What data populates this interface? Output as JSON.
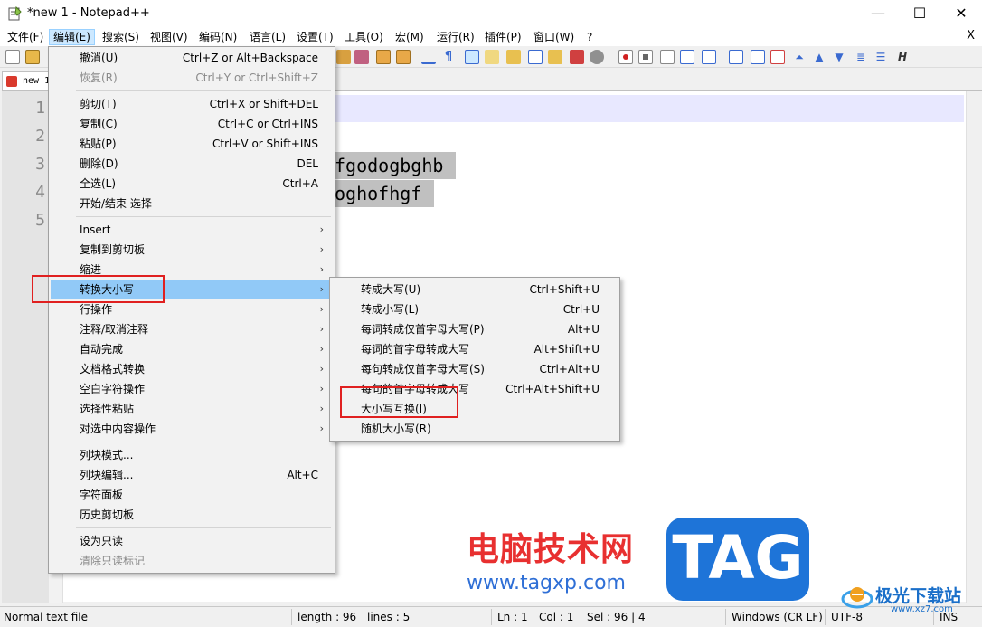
{
  "window": {
    "title": "*new 1 - Notepad++",
    "minimize": "—",
    "maximize": "☐",
    "close": "✕"
  },
  "menubar": {
    "items": [
      "文件(F)",
      "编辑(E)",
      "搜索(S)",
      "视图(V)",
      "编码(N)",
      "语言(L)",
      "设置(T)",
      "工具(O)",
      "宏(M)",
      "运行(R)",
      "插件(P)",
      "窗口(W)",
      "?"
    ],
    "close": "X"
  },
  "tab": {
    "label": "new 1"
  },
  "editor": {
    "line_numbers": [
      "1",
      "2",
      "3",
      "4",
      "5"
    ],
    "visible_text": [
      "fgodogbghb",
      "oghofhgf"
    ]
  },
  "edit_menu": {
    "items": [
      {
        "label": "撤消(U)",
        "shortcut": "Ctrl+Z or Alt+Backspace"
      },
      {
        "label": "恢复(R)",
        "shortcut": "Ctrl+Y or Ctrl+Shift+Z",
        "disabled": true
      },
      {
        "label": "剪切(T)",
        "shortcut": "Ctrl+X or Shift+DEL"
      },
      {
        "label": "复制(C)",
        "shortcut": "Ctrl+C or Ctrl+INS"
      },
      {
        "label": "粘贴(P)",
        "shortcut": "Ctrl+V or Shift+INS"
      },
      {
        "label": "删除(D)",
        "shortcut": "DEL"
      },
      {
        "label": "全选(L)",
        "shortcut": "Ctrl+A"
      },
      {
        "label": "开始/结束 选择",
        "shortcut": ""
      },
      {
        "label": "Insert",
        "submenu": true
      },
      {
        "label": "复制到剪切板",
        "submenu": true
      },
      {
        "label": "缩进",
        "submenu": true
      },
      {
        "label": "转换大小写",
        "submenu": true,
        "highlighted": true
      },
      {
        "label": "行操作",
        "submenu": true
      },
      {
        "label": "注释/取消注释",
        "submenu": true
      },
      {
        "label": "自动完成",
        "submenu": true
      },
      {
        "label": "文档格式转换",
        "submenu": true
      },
      {
        "label": "空白字符操作",
        "submenu": true
      },
      {
        "label": "选择性粘贴",
        "submenu": true
      },
      {
        "label": "对选中内容操作",
        "submenu": true
      },
      {
        "label": "列块模式...",
        "shortcut": ""
      },
      {
        "label": "列块编辑...",
        "shortcut": "Alt+C"
      },
      {
        "label": "字符面板",
        "shortcut": ""
      },
      {
        "label": "历史剪切板",
        "shortcut": ""
      },
      {
        "label": "设为只读",
        "shortcut": ""
      },
      {
        "label": "清除只读标记",
        "shortcut": "",
        "disabled": true
      }
    ]
  },
  "case_submenu": {
    "items": [
      {
        "label": "转成大写(U)",
        "shortcut": "Ctrl+Shift+U"
      },
      {
        "label": "转成小写(L)",
        "shortcut": "Ctrl+U"
      },
      {
        "label": "每词转成仅首字母大写(P)",
        "shortcut": "Alt+U"
      },
      {
        "label": "每词的首字母转成大写",
        "shortcut": "Alt+Shift+U"
      },
      {
        "label": "每句转成仅首字母大写(S)",
        "shortcut": "Ctrl+Alt+U"
      },
      {
        "label": "每句的首字母转成大写",
        "shortcut": "Ctrl+Alt+Shift+U"
      },
      {
        "label": "大小写互换(I)",
        "shortcut": ""
      },
      {
        "label": "随机大小写(R)",
        "shortcut": ""
      }
    ]
  },
  "statusbar": {
    "file_type": "Normal text file",
    "length": "length : 96",
    "lines": "lines : 5",
    "ln": "Ln : 1",
    "col": "Col : 1",
    "sel": "Sel : 96 | 4",
    "eol": "Windows (CR LF)",
    "encoding": "UTF-8",
    "mode": "INS"
  },
  "watermark": {
    "title": "电脑技术网",
    "url": "www.tagxp.com",
    "tag": "TAG",
    "site": "极光下载站",
    "site_url": "www.xz7.com"
  },
  "colors": {
    "menu_highlight": "#91c9f7",
    "annotation_red": "#e02020",
    "tag_blue": "#1e74d8"
  }
}
